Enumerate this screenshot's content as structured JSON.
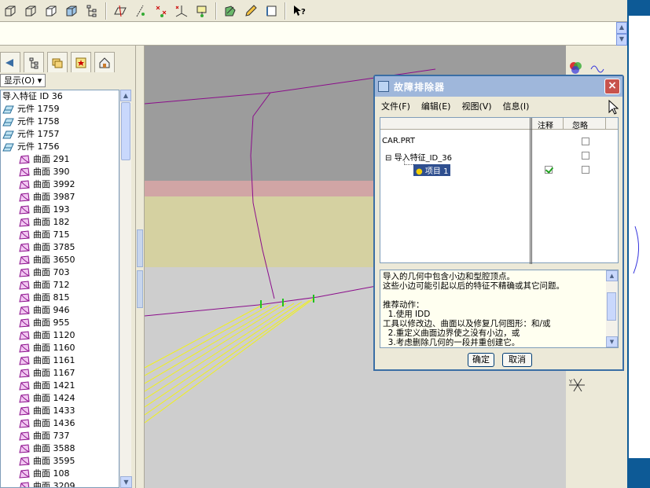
{
  "toolbar": {
    "icons": [
      "cube-wireframe-icon",
      "cube-hidden-icon",
      "cube-no-hidden-icon",
      "cube-shaded-icon",
      "model-tree-icon",
      "datum-plane-icon",
      "datum-axis-icon",
      "datum-point-icon",
      "coordinate-system-icon",
      "datum-plane-select-icon",
      "sketch-icon",
      "pencil-icon",
      "box-icon",
      "whats-this-icon"
    ]
  },
  "left_panel": {
    "show_button": "显示(O)",
    "tree": [
      {
        "label": "导入特征 ID 36",
        "level": 0,
        "icon": "none"
      },
      {
        "label": "元件 1759",
        "level": 0,
        "icon": "component-icon"
      },
      {
        "label": "元件 1758",
        "level": 0,
        "icon": "component-icon"
      },
      {
        "label": "元件 1757",
        "level": 0,
        "icon": "component-icon"
      },
      {
        "label": "元件 1756",
        "level": 0,
        "icon": "component-icon"
      },
      {
        "label": "曲面 291",
        "level": 1,
        "icon": "surface-icon"
      },
      {
        "label": "曲面 390",
        "level": 1,
        "icon": "surface-icon"
      },
      {
        "label": "曲面 3992",
        "level": 1,
        "icon": "surface-icon"
      },
      {
        "label": "曲面 3987",
        "level": 1,
        "icon": "surface-icon"
      },
      {
        "label": "曲面 193",
        "level": 1,
        "icon": "surface-icon"
      },
      {
        "label": "曲面 182",
        "level": 1,
        "icon": "surface-icon"
      },
      {
        "label": "曲面 715",
        "level": 1,
        "icon": "surface-icon"
      },
      {
        "label": "曲面 3785",
        "level": 1,
        "icon": "surface-icon"
      },
      {
        "label": "曲面 3650",
        "level": 1,
        "icon": "surface-icon"
      },
      {
        "label": "曲面 703",
        "level": 1,
        "icon": "surface-icon"
      },
      {
        "label": "曲面 712",
        "level": 1,
        "icon": "surface-icon"
      },
      {
        "label": "曲面 815",
        "level": 1,
        "icon": "surface-icon"
      },
      {
        "label": "曲面 946",
        "level": 1,
        "icon": "surface-icon"
      },
      {
        "label": "曲面 955",
        "level": 1,
        "icon": "surface-icon"
      },
      {
        "label": "曲面 1120",
        "level": 1,
        "icon": "surface-icon"
      },
      {
        "label": "曲面 1160",
        "level": 1,
        "icon": "surface-icon"
      },
      {
        "label": "曲面 1161",
        "level": 1,
        "icon": "surface-icon"
      },
      {
        "label": "曲面 1167",
        "level": 1,
        "icon": "surface-icon"
      },
      {
        "label": "曲面 1421",
        "level": 1,
        "icon": "surface-icon"
      },
      {
        "label": "曲面 1424",
        "level": 1,
        "icon": "surface-icon"
      },
      {
        "label": "曲面 1433",
        "level": 1,
        "icon": "surface-icon"
      },
      {
        "label": "曲面 1436",
        "level": 1,
        "icon": "surface-icon"
      },
      {
        "label": "曲面 737",
        "level": 1,
        "icon": "surface-icon"
      },
      {
        "label": "曲面 3588",
        "level": 1,
        "icon": "surface-icon"
      },
      {
        "label": "曲面 3595",
        "level": 1,
        "icon": "surface-icon"
      },
      {
        "label": "曲面 108",
        "level": 1,
        "icon": "surface-icon"
      },
      {
        "label": "曲面 3209",
        "level": 1,
        "icon": "surface-icon"
      }
    ]
  },
  "dialog": {
    "title": "故障排除器",
    "close_label": "×",
    "menu": [
      "文件(F)",
      "编辑(E)",
      "视图(V)",
      "信息(I)"
    ],
    "columns": {
      "note": "注释",
      "ignore": "忽略"
    },
    "items": [
      {
        "label": "CAR.PRT",
        "note": false,
        "ignore": true
      },
      {
        "label": "导入特征_ID_36",
        "note": false,
        "ignore": true
      },
      {
        "label": "项目 1",
        "note": true,
        "ignore": true
      }
    ],
    "message_lines": [
      "导入的几何中包含小边和型腔顶点。",
      "这些小边可能引起以后的特征不精确或其它问题。",
      "",
      "推荐动作：",
      "  1.使用 IDD",
      "工具以修改边、曲面以及修复几何图形：和/或",
      "  2.重定义曲面边界使之没有小边，或",
      "  3.考虑删除几何的一段并重创建它。"
    ],
    "ok_label": "确定",
    "cancel_label": "取消"
  },
  "colors": {
    "viewport_gray": "#9c9c9c",
    "viewport_pink": "#d1a5a5",
    "viewport_khaki": "#d5d1a1",
    "viewport_light": "#cecece",
    "curve_purple": "#8b0d8b",
    "edge_yellow": "#f1f11a",
    "title_blue": "#9fb7db",
    "accent_blue": "#0d5a96"
  }
}
